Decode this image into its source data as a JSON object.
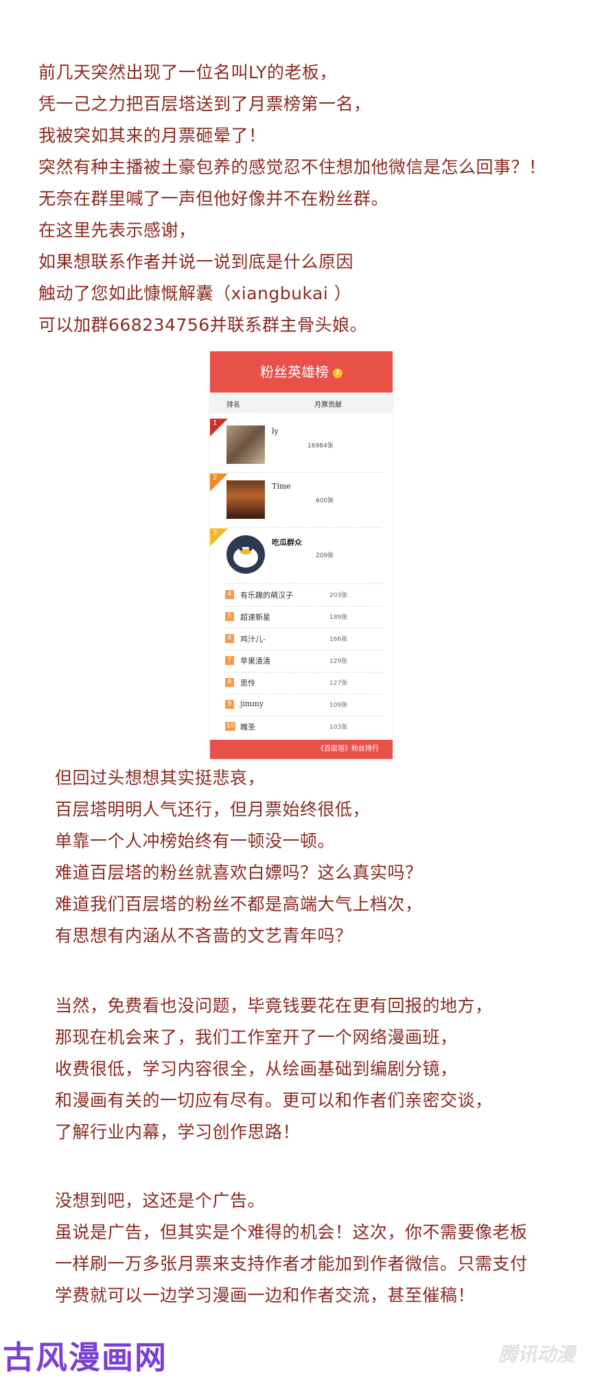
{
  "intro_lines": [
    "前几天突然出现了一位名叫LY的老板，",
    "凭一己之力把百层塔送到了月票榜第一名，",
    "我被突如其来的月票砸晕了！",
    "突然有种主播被土豪包养的感觉忍不住想加他微信是怎么回事？！",
    "无奈在群里喊了一声但他好像并不在粉丝群。",
    "在这里先表示感谢，",
    "如果想联系作者并说一说到底是什么原因",
    "触动了您如此慷慨解囊（xiangbukai ）",
    "可以加群668234756并联系群主骨头娘。"
  ],
  "ranking": {
    "title": "粉丝英雄榜",
    "help_icon": "question-icon",
    "col_rank": "排名",
    "col_votes": "月票贡献",
    "top": [
      {
        "rank": "1",
        "name": "ly",
        "votes": "16984张",
        "color": "#d42c2c"
      },
      {
        "rank": "2",
        "name": "Time",
        "votes": "600张",
        "color": "#f08a2a"
      },
      {
        "rank": "3",
        "name": "吃瓜群众",
        "votes": "209张",
        "color": "#f5b820"
      }
    ],
    "others": [
      {
        "rank": "4",
        "name": "有乐趣的萌汉子",
        "votes": "203张"
      },
      {
        "rank": "5",
        "name": "超速新星",
        "votes": "189张"
      },
      {
        "rank": "6",
        "name": "鸡汁儿-",
        "votes": "166张"
      },
      {
        "rank": "7",
        "name": "苹果清清",
        "votes": "129张"
      },
      {
        "rank": "8",
        "name": "思怜",
        "votes": "127张"
      },
      {
        "rank": "9",
        "name": "jimmy",
        "votes": "109张"
      },
      {
        "rank": "10",
        "name": "魄圣",
        "votes": "103张"
      }
    ],
    "footer": "《百层塔》粉丝排行"
  },
  "middle_lines": [
    "但回过头想想其实挺悲哀，",
    "百层塔明明人气还行，但月票始终很低，",
    "单靠一个人冲榜始终有一顿没一顿。",
    "难道百层塔的粉丝就喜欢白嫖吗？这么真实吗？",
    "难道我们百层塔的粉丝不都是高端大气上档次，",
    "有思想有内涵从不吝啬的文艺青年吗？"
  ],
  "ad_lines": [
    "当然，免费看也没问题，毕竟钱要花在更有回报的地方，",
    "那现在机会来了，我们工作室开了一个网络漫画班，",
    "收费很低，学习内容很全，从绘画基础到编剧分镜，",
    "和漫画有关的一切应有尽有。更可以和作者们亲密交谈，",
    "了解行业内幕，学习创作思路！"
  ],
  "closing_lines": [
    "没想到吧，这还是个广告。",
    "虽说是广告，但其实是个难得的机会！这次，你不需要像老板",
    "一样刷一万多张月票来支持作者才能加到作者微信。只需支付",
    "学费就可以一边学习漫画一边和作者交流，甚至催稿！"
  ],
  "watermark_left": "古风漫画网",
  "watermark_right": "腾讯动漫"
}
